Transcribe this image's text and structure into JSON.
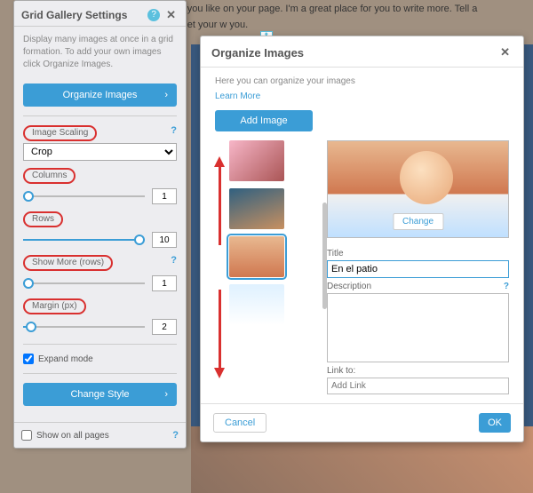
{
  "bg_text": "anywhere you like on your page. I'm a great place for you to write more. Tell a story and let your w you.",
  "panel": {
    "title": "Grid Gallery Settings",
    "description": "Display many images at once in a grid formation. To add your own images click Organize Images.",
    "organize_btn": "Organize Images",
    "scaling": {
      "label": "Image Scaling",
      "value": "Crop"
    },
    "columns": {
      "label": "Columns",
      "value": "1"
    },
    "rows": {
      "label": "Rows",
      "value": "10"
    },
    "show_more": {
      "label": "Show More (rows)",
      "value": "1"
    },
    "margin": {
      "label": "Margin (px)",
      "value": "2"
    },
    "expand": "Expand mode",
    "change_style": "Change Style",
    "show_all": "Show on all pages"
  },
  "modal": {
    "title": "Organize Images",
    "sub": "Here you can organize your images",
    "learn": "Learn More",
    "add": "Add Image",
    "change": "Change",
    "title_lbl": "Title",
    "title_val": "En el patio",
    "desc_lbl": "Description",
    "link_lbl": "Link to:",
    "link_ph": "Add Link",
    "cancel": "Cancel",
    "ok": "OK"
  }
}
